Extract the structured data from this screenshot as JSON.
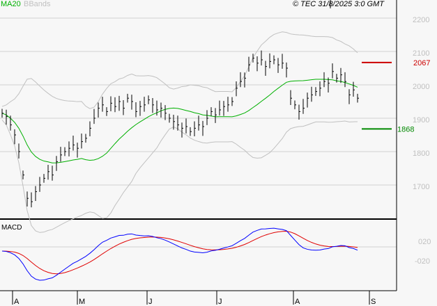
{
  "header": {
    "ma_label": "MA20",
    "bb_label": "BBands",
    "copyright": "© TEC 31/8/2025 3:0 GMT"
  },
  "colors": {
    "ma": "#00b000",
    "bands": "#c0c0c0",
    "macd": "#0000ff",
    "signal": "#e00000",
    "resistance": "#cc0000",
    "support": "#008800"
  },
  "chart_data": {
    "type": "ohlc",
    "title": "",
    "price_axis": {
      "ticks": [
        "2200",
        "2100",
        "2000",
        "1900",
        "1800",
        "1700"
      ],
      "ylim": [
        1625,
        2255
      ]
    },
    "months": [
      "A",
      "M",
      "J",
      "J",
      "A",
      "S"
    ],
    "closes": [
      1915,
      1905,
      1880,
      1850,
      1800,
      1730,
      1660,
      1650,
      1680,
      1700,
      1720,
      1740,
      1730,
      1770,
      1790,
      1800,
      1810,
      1820,
      1810,
      1830,
      1840,
      1870,
      1900,
      1930,
      1940,
      1920,
      1945,
      1935,
      1950,
      1930,
      1960,
      1950,
      1920,
      1935,
      1940,
      1955,
      1940,
      1925,
      1930,
      1915,
      1900,
      1890,
      1880,
      1870,
      1875,
      1860,
      1870,
      1880,
      1875,
      1900,
      1920,
      1910,
      1925,
      1935,
      1940,
      1950,
      1990,
      2010,
      2020,
      2060,
      2080,
      2065,
      2075,
      2055,
      2070,
      2075,
      2060,
      2065,
      2050,
      1960,
      1940,
      1920,
      1930,
      1960,
      1970,
      1980,
      1990,
      2010,
      2005,
      2040,
      2020,
      2030,
      2010,
      1970,
      1985,
      1960
    ],
    "bar_half_range": 22,
    "resistance": {
      "value": 2067,
      "label": "2067"
    },
    "support": {
      "value": 1868,
      "label": "1868"
    },
    "macd": {
      "label": "MACD",
      "ticks": [
        "020",
        "-020"
      ]
    }
  }
}
